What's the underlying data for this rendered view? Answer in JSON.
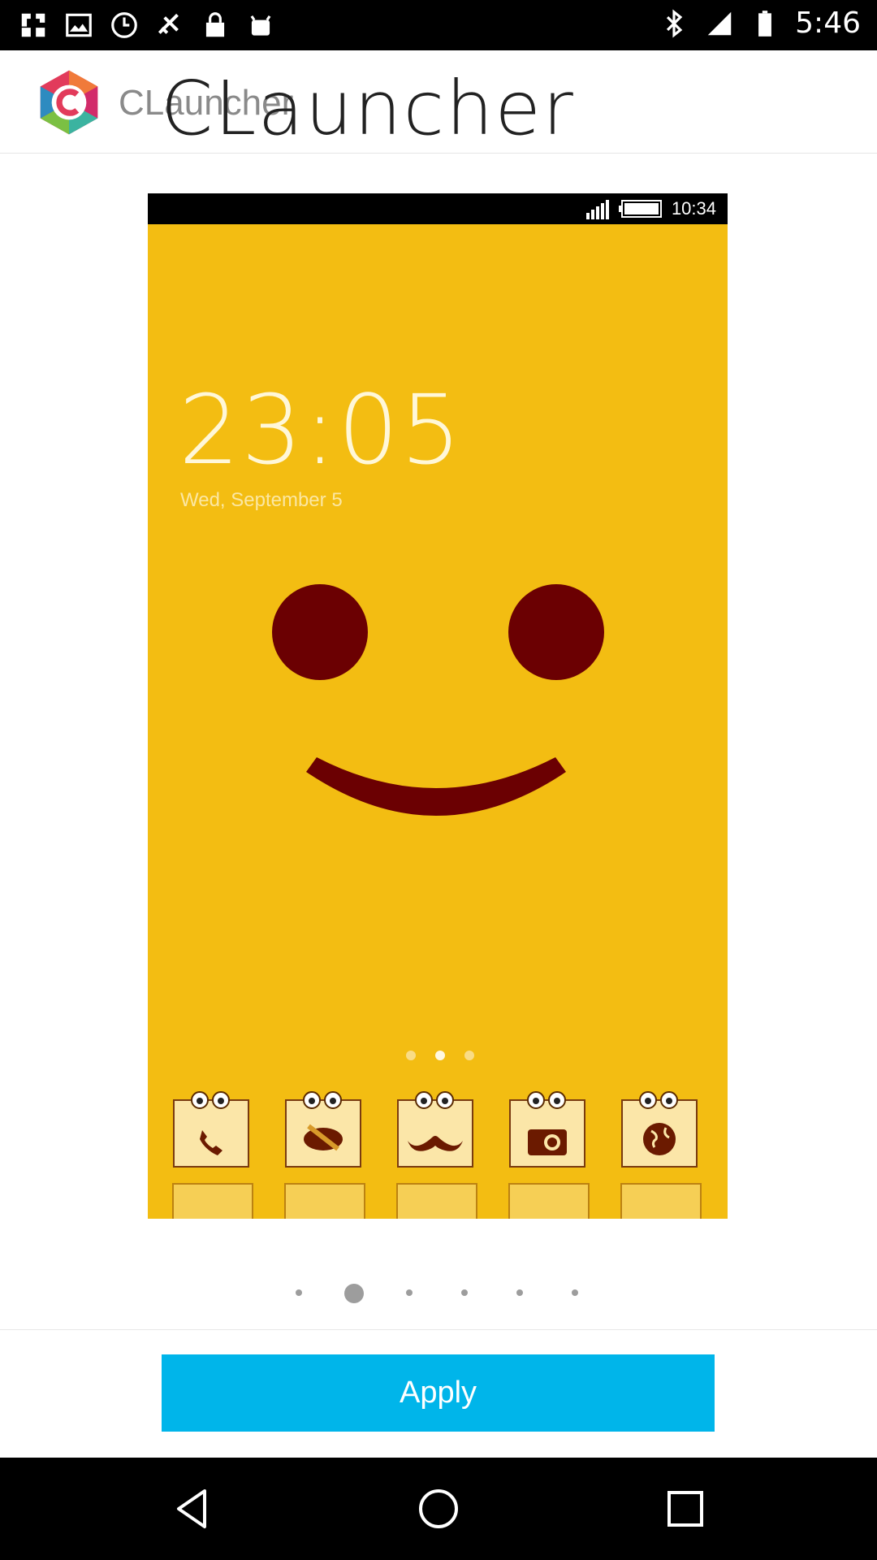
{
  "status_bar": {
    "time": "5:46",
    "icons": [
      "fake-gps-icon",
      "image-icon",
      "sync-icon",
      "no-satellite-icon",
      "lock-icon",
      "android-icon",
      "bluetooth-icon",
      "signal-icon",
      "battery-icon"
    ]
  },
  "header": {
    "logo_icon": "clauncher-logo-icon",
    "title_small": "CLauncher",
    "title_large": "CLauncher"
  },
  "preview": {
    "status_time": "10:34",
    "clock": "23:05",
    "date": "Wed, September 5",
    "colors": {
      "background": "#f3bd12",
      "face": "#6b0002"
    },
    "dock_icons": [
      "phone-icon",
      "pencil-icon",
      "mustache-icon",
      "camera-icon",
      "globe-icon"
    ]
  },
  "pager": {
    "count": 6,
    "active_index": 1
  },
  "actions": {
    "apply_label": "Apply",
    "accent": "#00b5ea"
  },
  "nav_bar": {
    "icons": [
      "back-icon",
      "home-icon",
      "recents-icon"
    ]
  }
}
